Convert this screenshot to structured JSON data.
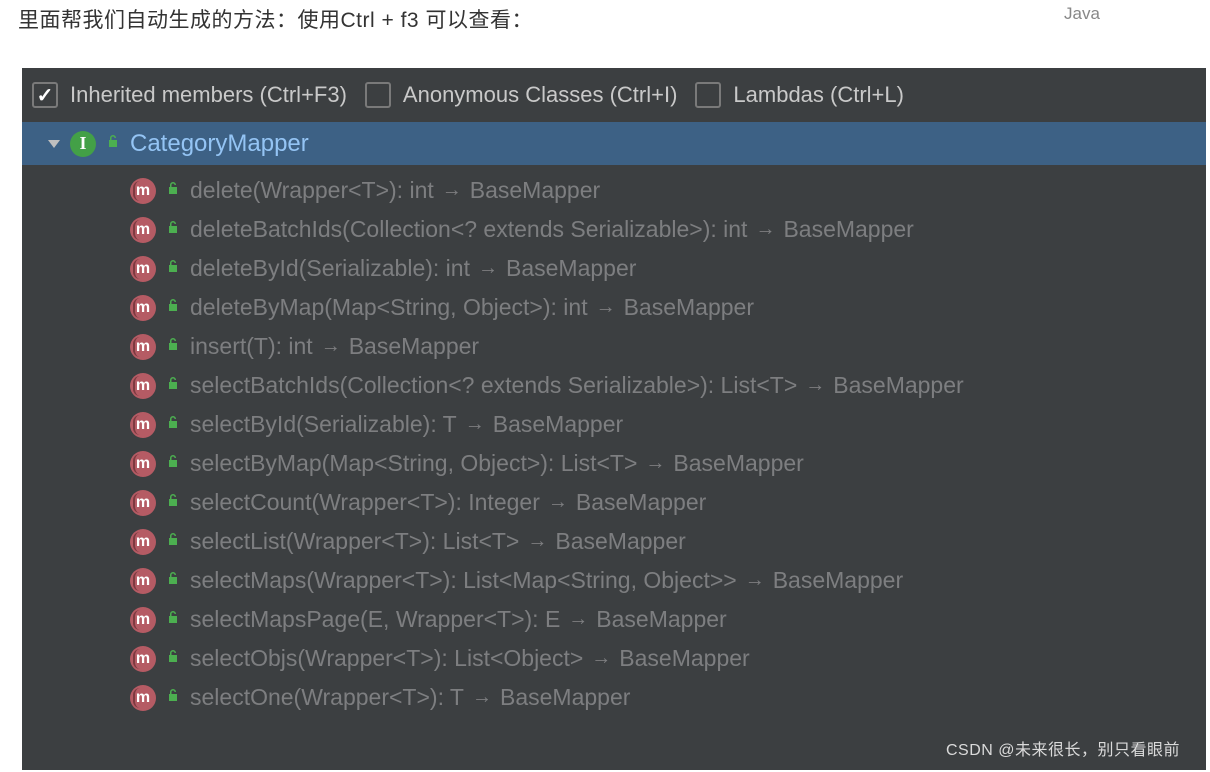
{
  "desc": "里面帮我们自动生成的方法：使用Ctrl + f3  可以查看：",
  "java_tag": "Java",
  "toolbar": {
    "inherited": {
      "checked": true,
      "label": "Inherited members (Ctrl+F3)"
    },
    "anon": {
      "checked": false,
      "label": "Anonymous Classes (Ctrl+I)"
    },
    "lambdas": {
      "checked": false,
      "label": "Lambdas (Ctrl+L)"
    }
  },
  "tree": {
    "root": "CategoryMapper",
    "methods": [
      {
        "sig": "delete(Wrapper<T>): int",
        "from": "BaseMapper"
      },
      {
        "sig": "deleteBatchIds(Collection<? extends Serializable>): int",
        "from": "BaseMapper"
      },
      {
        "sig": "deleteById(Serializable): int",
        "from": "BaseMapper"
      },
      {
        "sig": "deleteByMap(Map<String, Object>): int",
        "from": "BaseMapper"
      },
      {
        "sig": "insert(T): int",
        "from": "BaseMapper"
      },
      {
        "sig": "selectBatchIds(Collection<? extends Serializable>): List<T>",
        "from": "BaseMapper"
      },
      {
        "sig": "selectById(Serializable): T",
        "from": "BaseMapper"
      },
      {
        "sig": "selectByMap(Map<String, Object>): List<T>",
        "from": "BaseMapper"
      },
      {
        "sig": "selectCount(Wrapper<T>): Integer",
        "from": "BaseMapper"
      },
      {
        "sig": "selectList(Wrapper<T>): List<T>",
        "from": "BaseMapper"
      },
      {
        "sig": "selectMaps(Wrapper<T>): List<Map<String, Object>>",
        "from": "BaseMapper"
      },
      {
        "sig": "selectMapsPage(E, Wrapper<T>): E",
        "from": "BaseMapper"
      },
      {
        "sig": "selectObjs(Wrapper<T>): List<Object>",
        "from": "BaseMapper"
      },
      {
        "sig": "selectOne(Wrapper<T>): T",
        "from": "BaseMapper"
      }
    ]
  },
  "watermark": "CSDN @未来很长，别只看眼前"
}
